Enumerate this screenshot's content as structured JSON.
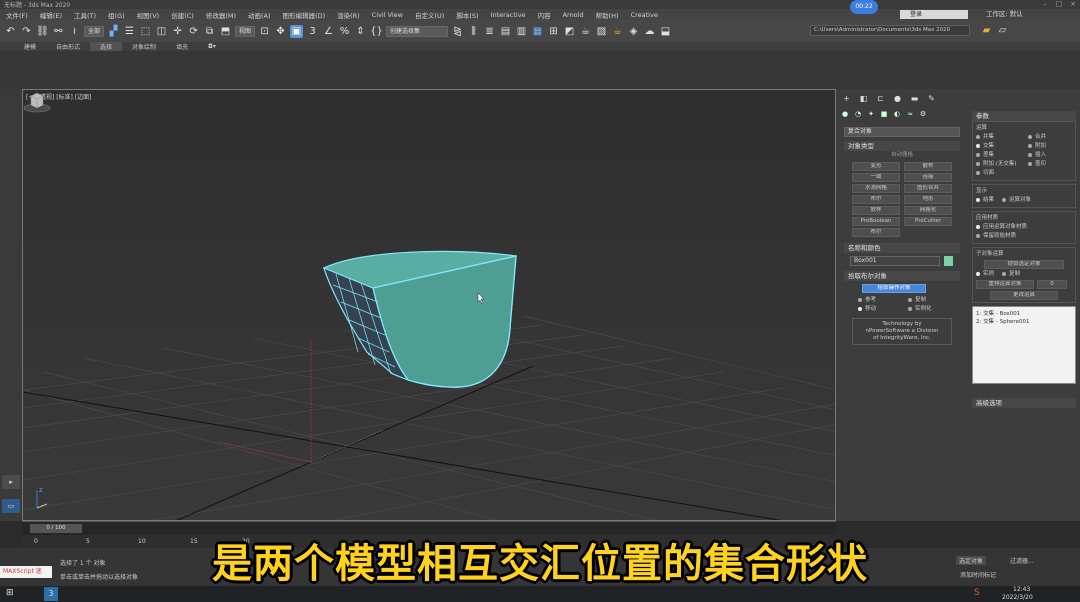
{
  "window": {
    "title": "无标题 - 3ds Max 2020",
    "record_badge": "00:22"
  },
  "menu": {
    "items": [
      "文件(F)",
      "编辑(E)",
      "工具(T)",
      "组(G)",
      "视图(V)",
      "创建(C)",
      "修改器(M)",
      "动画(A)",
      "图形编辑器(D)",
      "渲染(R)",
      "Civil View",
      "自定义(U)",
      "脚本(S)",
      "Interactive",
      "内容",
      "Arnold",
      "帮助(H)",
      "Creative"
    ],
    "user": "登录",
    "workspace": "工作区: 默认"
  },
  "toolbar": {
    "filter_all": "全部",
    "ref_coord": "视图",
    "named_set": "创建选择集",
    "path": "C:\\Users\\Administrator\\Documents\\3ds Max 2020"
  },
  "ribbon": {
    "tabs": [
      "建模",
      "自由形式",
      "选择",
      "对象绘制",
      "填充"
    ],
    "active": "选择"
  },
  "viewport": {
    "label": "[+] [透视] [标准] [边面]",
    "mesh_color": "#4f9e94",
    "edge_color": "#7fe6ff"
  },
  "command_panel": {
    "category": "复合对象",
    "object_type_title": "对象类型",
    "autogrid": "自动栅格",
    "buttons": [
      "变形",
      "散布",
      "一致",
      "连接",
      "水滴网格",
      "图形合并",
      "布尔",
      "地形",
      "放样",
      "网格化",
      "ProBoolean",
      "ProCutter",
      "布尔"
    ],
    "name_color_title": "名称和颜色",
    "object_name": "Box001",
    "object_color": "#7fcfa8",
    "pick_title": "拾取布尔对象",
    "pick_button": "拾取操作对象",
    "pick_options": [
      {
        "label": "参考",
        "on": false
      },
      {
        "label": "复制",
        "on": false
      },
      {
        "label": "移动",
        "on": true
      },
      {
        "label": "实例化",
        "on": false
      }
    ],
    "tech_note": [
      "Technology by",
      "nPowerSoftware a Division",
      "of IntegrityWare, Inc."
    ],
    "params_title": "参数",
    "operation_label": "运算",
    "operations": [
      {
        "label": "并集",
        "on": false
      },
      {
        "label": "合并",
        "on": false
      },
      {
        "label": "交集",
        "on": true
      },
      {
        "label": "附加",
        "on": false
      },
      {
        "label": "差集",
        "on": false
      },
      {
        "label": "插入",
        "on": false
      },
      {
        "label": "附加 (无交集)",
        "on": false
      },
      {
        "label": "盖印",
        "on": false
      },
      {
        "label": "切面",
        "on": false
      }
    ],
    "display_label": "显示",
    "display_options": [
      "结果",
      "运算对象"
    ],
    "apply_material_label": "应用材质",
    "material_options": [
      "应用运算对象材质",
      "保留原始材质"
    ],
    "sub_object_label": "子对象运算",
    "extract_button": "提取选定对象",
    "sub_options": [
      "实例",
      "复制"
    ],
    "reorder_button": "重排运算对象",
    "reorder_value": "0",
    "change_button": "更改运算",
    "list_items": [
      "1: 交集 - Box001",
      "2: 交集 - Sphere001"
    ],
    "advanced_title": "高级选项"
  },
  "timeline": {
    "frame": "0 / 100",
    "ruler": [
      "0",
      "5",
      "10",
      "15",
      "20"
    ]
  },
  "status": {
    "maxscript": "MAXScript 迷",
    "selection": "选择了 1 个 对象",
    "prompt": "单击或单击并拖动以选择对象",
    "select_set": "选定对象",
    "filter": "过滤器...",
    "add_time_tag": "添加时间标记"
  },
  "taskbar": {
    "time": "12:43",
    "date": "2022/3/20"
  },
  "caption": "是两个模型相互交汇位置的集合形状"
}
